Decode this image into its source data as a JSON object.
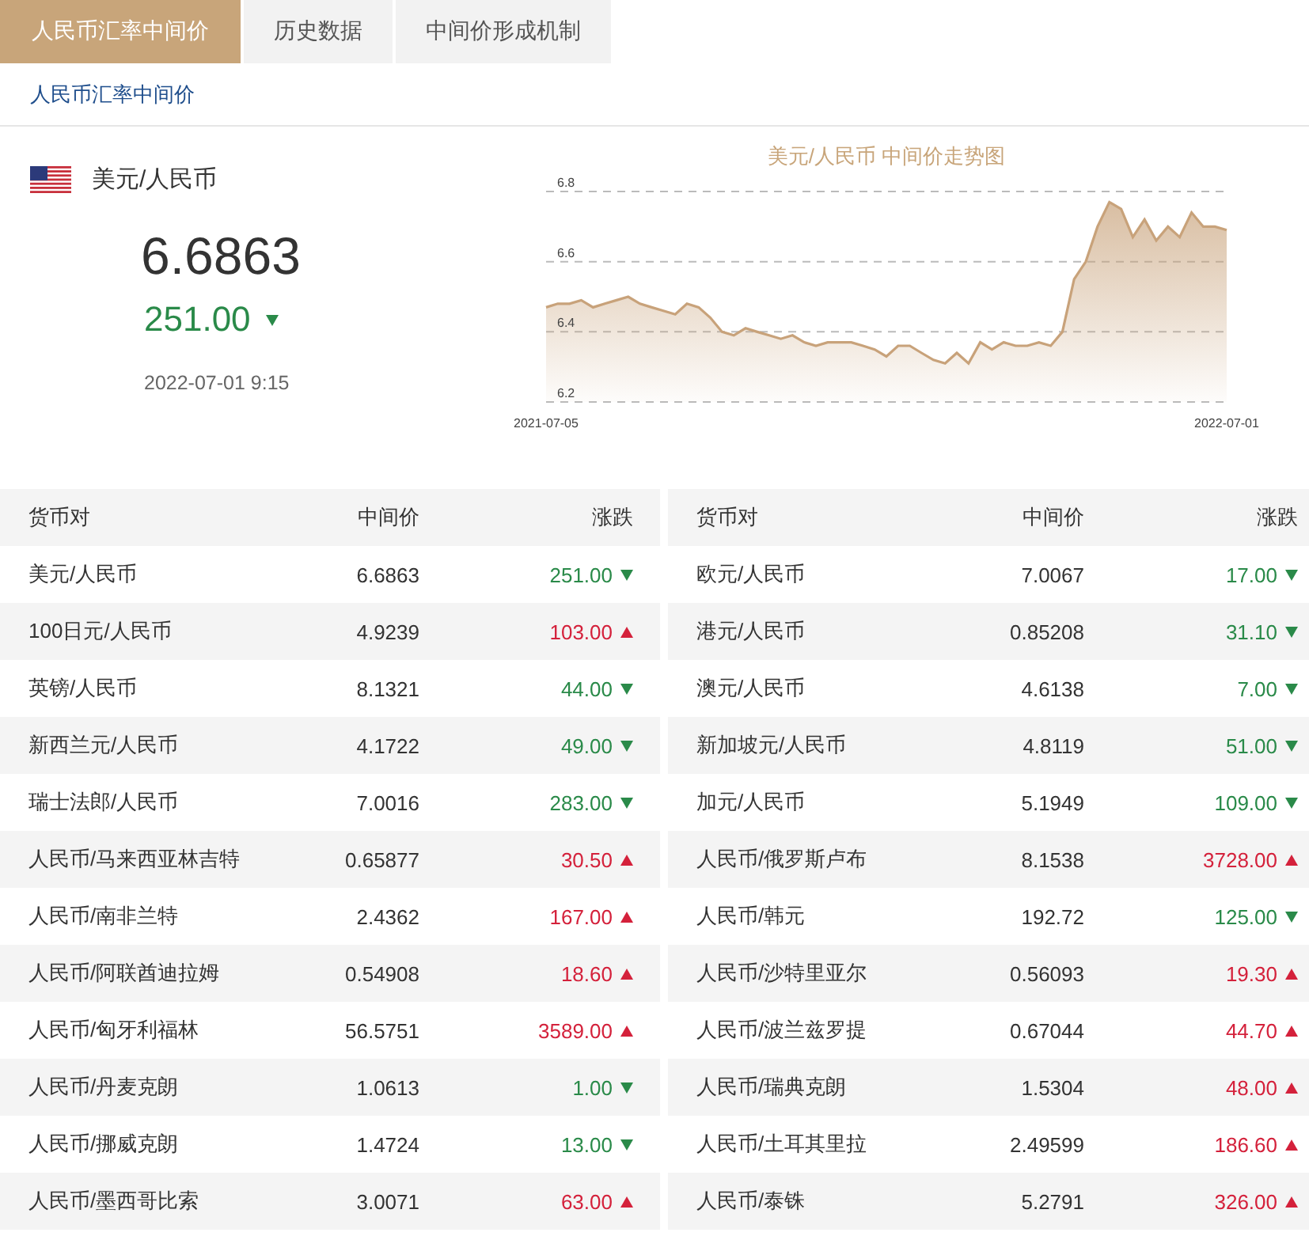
{
  "tabs": [
    {
      "label": "人民币汇率中间价",
      "selected": true
    },
    {
      "label": "历史数据",
      "selected": false
    },
    {
      "label": "中间价形成机制",
      "selected": false
    }
  ],
  "subtitle": "人民币汇率中间价",
  "summary": {
    "pair": "美元/人民币",
    "price": "6.6863",
    "change": "251.00",
    "kind": "down",
    "time": "2022-07-01 9:15"
  },
  "chart": {
    "axis_start": "2021-07-05",
    "axis_end": "2022-07-01",
    "chart_data": {
      "type": "area",
      "title": "美元/人民币 中间价走势图",
      "ylim": [
        6.2,
        6.8
      ],
      "yticks": [
        6.2,
        6.4,
        6.6,
        6.8
      ],
      "series": [
        {
          "color": "#c8a27a",
          "values": [
            6.47,
            6.48,
            6.48,
            6.49,
            6.47,
            6.48,
            6.49,
            6.5,
            6.48,
            6.47,
            6.46,
            6.45,
            6.48,
            6.47,
            6.44,
            6.4,
            6.39,
            6.41,
            6.4,
            6.39,
            6.38,
            6.39,
            6.37,
            6.36,
            6.37,
            6.37,
            6.37,
            6.36,
            6.35,
            6.33,
            6.36,
            6.36,
            6.34,
            6.32,
            6.31,
            6.34,
            6.31,
            6.37,
            6.35,
            6.37,
            6.36,
            6.36,
            6.37,
            6.36,
            6.4,
            6.55,
            6.6,
            6.7,
            6.77,
            6.75,
            6.67,
            6.72,
            6.66,
            6.7,
            6.67,
            6.74,
            6.7,
            6.7,
            6.69
          ]
        }
      ]
    }
  },
  "tables": [
    {
      "columns": [
        "货币对",
        "中间价",
        "涨跌"
      ],
      "rows": [
        {
          "pair": "美元/人民币",
          "price": "6.6863",
          "change": "251.00",
          "kind": "down"
        },
        {
          "pair": "100日元/人民币",
          "price": "4.9239",
          "change": "103.00",
          "kind": "up"
        },
        {
          "pair": "英镑/人民币",
          "price": "8.1321",
          "change": "44.00",
          "kind": "down"
        },
        {
          "pair": "新西兰元/人民币",
          "price": "4.1722",
          "change": "49.00",
          "kind": "down"
        },
        {
          "pair": "瑞士法郎/人民币",
          "price": "7.0016",
          "change": "283.00",
          "kind": "down"
        },
        {
          "pair": "人民币/马来西亚林吉特",
          "price": "0.65877",
          "change": "30.50",
          "kind": "up"
        },
        {
          "pair": "人民币/南非兰特",
          "price": "2.4362",
          "change": "167.00",
          "kind": "up"
        },
        {
          "pair": "人民币/阿联酋迪拉姆",
          "price": "0.54908",
          "change": "18.60",
          "kind": "up"
        },
        {
          "pair": "人民币/匈牙利福林",
          "price": "56.5751",
          "change": "3589.00",
          "kind": "up"
        },
        {
          "pair": "人民币/丹麦克朗",
          "price": "1.0613",
          "change": "1.00",
          "kind": "down"
        },
        {
          "pair": "人民币/挪威克朗",
          "price": "1.4724",
          "change": "13.00",
          "kind": "down"
        },
        {
          "pair": "人民币/墨西哥比索",
          "price": "3.0071",
          "change": "63.00",
          "kind": "up"
        }
      ]
    },
    {
      "columns": [
        "货币对",
        "中间价",
        "涨跌"
      ],
      "rows": [
        {
          "pair": "欧元/人民币",
          "price": "7.0067",
          "change": "17.00",
          "kind": "down"
        },
        {
          "pair": "港元/人民币",
          "price": "0.85208",
          "change": "31.10",
          "kind": "down"
        },
        {
          "pair": "澳元/人民币",
          "price": "4.6138",
          "change": "7.00",
          "kind": "down"
        },
        {
          "pair": "新加坡元/人民币",
          "price": "4.8119",
          "change": "51.00",
          "kind": "down"
        },
        {
          "pair": "加元/人民币",
          "price": "5.1949",
          "change": "109.00",
          "kind": "down"
        },
        {
          "pair": "人民币/俄罗斯卢布",
          "price": "8.1538",
          "change": "3728.00",
          "kind": "up"
        },
        {
          "pair": "人民币/韩元",
          "price": "192.72",
          "change": "125.00",
          "kind": "down"
        },
        {
          "pair": "人民币/沙特里亚尔",
          "price": "0.56093",
          "change": "19.30",
          "kind": "up"
        },
        {
          "pair": "人民币/波兰兹罗提",
          "price": "0.67044",
          "change": "44.70",
          "kind": "up"
        },
        {
          "pair": "人民币/瑞典克朗",
          "price": "1.5304",
          "change": "48.00",
          "kind": "up"
        },
        {
          "pair": "人民币/土耳其里拉",
          "price": "2.49599",
          "change": "186.60",
          "kind": "up"
        },
        {
          "pair": "人民币/泰铢",
          "price": "5.2791",
          "change": "326.00",
          "kind": "up"
        }
      ]
    }
  ]
}
